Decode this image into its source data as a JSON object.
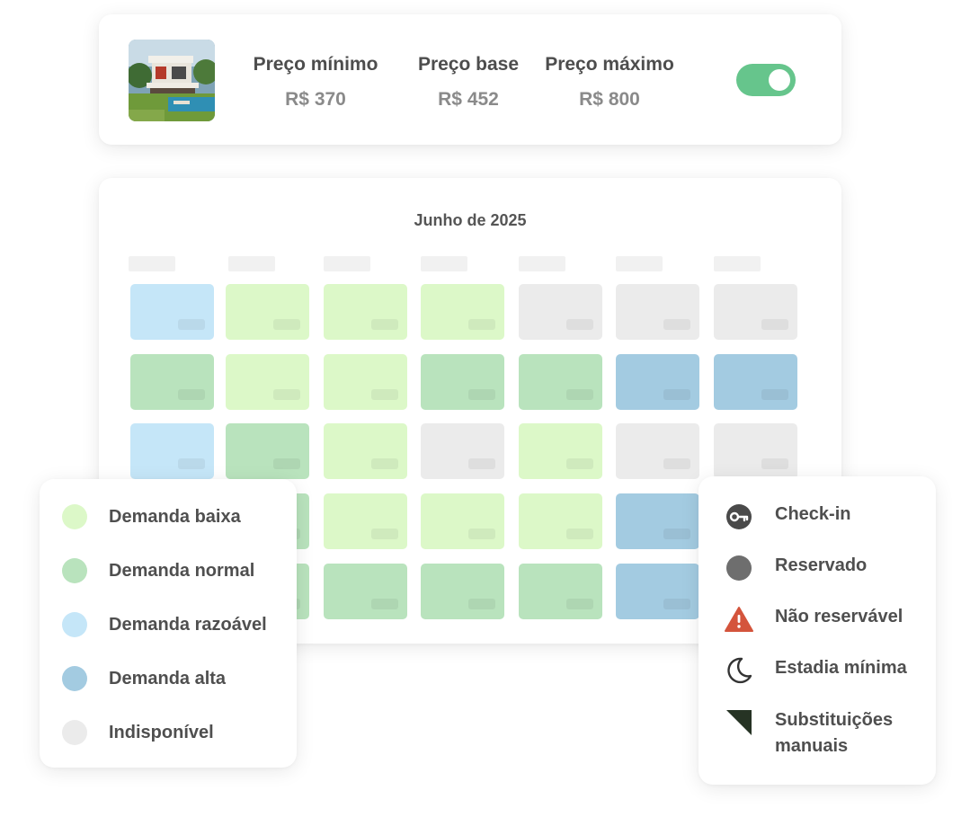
{
  "pricing": {
    "min_label": "Preço mínimo",
    "min_value": "R$ 370",
    "base_label": "Preço base",
    "base_value": "R$ 452",
    "max_label": "Preço máximo",
    "max_value": "R$ 800",
    "toggle_on": true,
    "toggle_color": "#66c58c"
  },
  "calendar": {
    "title": "Junho de 2025",
    "weekday_count": 7,
    "rows": [
      [
        "razoavel",
        "baixa",
        "baixa",
        "baixa",
        "indisponivel",
        "indisponivel",
        "indisponivel"
      ],
      [
        "normal",
        "baixa",
        "baixa",
        "normal",
        "normal",
        "alta",
        "alta"
      ],
      [
        "razoavel",
        "normal",
        "baixa",
        "indisponivel",
        "baixa",
        "indisponivel",
        "indisponivel"
      ],
      [
        "normal",
        "normal",
        "baixa",
        "baixa",
        "baixa",
        "alta",
        "alta"
      ],
      [
        "normal",
        "normal",
        "normal",
        "normal",
        "normal",
        "alta",
        "alta"
      ]
    ],
    "colors": {
      "baixa": "#dcf8c8",
      "normal": "#b9e3bd",
      "razoavel": "#c5e6f8",
      "alta": "#a3cbe1",
      "indisponivel": "#ebebeb"
    }
  },
  "legend_demand": [
    {
      "label": "Demanda baixa",
      "color": "#dcf8c8"
    },
    {
      "label": "Demanda normal",
      "color": "#b9e3bd"
    },
    {
      "label": "Demanda razoável",
      "color": "#c5e6f8"
    },
    {
      "label": "Demanda alta",
      "color": "#a3cbe1"
    },
    {
      "label": "Indisponível",
      "color": "#ebebeb"
    }
  ],
  "legend_symbols": [
    {
      "label": "Check-in",
      "icon": "key-icon"
    },
    {
      "label": "Reservado",
      "icon": "booked-dot-icon"
    },
    {
      "label": "Não reservável",
      "icon": "warning-icon"
    },
    {
      "label": "Estadia mínima",
      "icon": "moon-icon"
    },
    {
      "label": "Substituições manuais",
      "icon": "corner-flag-icon"
    }
  ]
}
